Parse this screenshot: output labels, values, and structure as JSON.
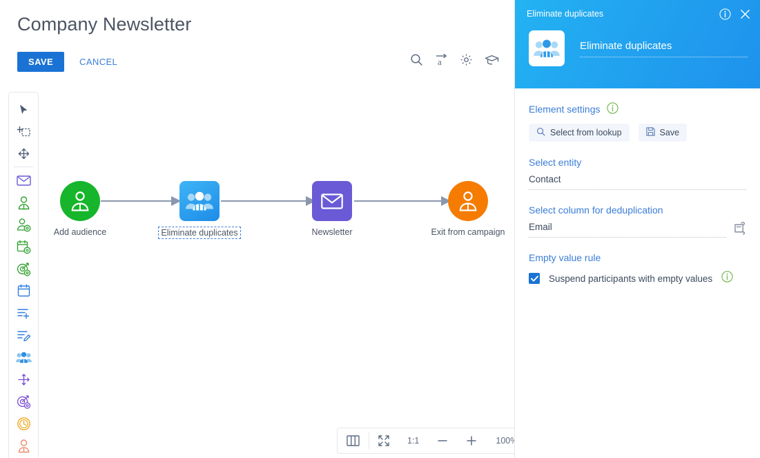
{
  "page": {
    "title": "Company Newsletter",
    "save_label": "SAVE",
    "cancel_label": "CANCEL"
  },
  "colors": {
    "primary_blue": "#1a73d4",
    "link_blue": "#3b7dd8",
    "panel_gradient_start": "#23b3f2",
    "panel_gradient_end": "#1e92ec",
    "node_green": "#16b52b",
    "node_blue": "#1d8ce8",
    "node_purple": "#6a5ad6",
    "node_orange": "#f57c00",
    "connector_gray": "#8b97ad",
    "info_green": "#6aba4a"
  },
  "canvas_tools": [
    {
      "name": "search-icon",
      "label": "Search"
    },
    {
      "name": "text-direction-icon",
      "label": "Text direction"
    },
    {
      "name": "gear-icon",
      "label": "Settings"
    },
    {
      "name": "graduation-cap-icon",
      "label": "Learning"
    }
  ],
  "tool_rail": [
    {
      "name": "pointer-icon",
      "label": "Select"
    },
    {
      "name": "add-selection-icon",
      "label": "Add to selection"
    },
    {
      "name": "move-icon",
      "label": "Move"
    },
    {
      "name": "separator",
      "label": ""
    },
    {
      "name": "envelope-icon",
      "label": "Email"
    },
    {
      "name": "audience-icon",
      "label": "Add audience"
    },
    {
      "name": "audience-filter-icon",
      "label": "Filter audience"
    },
    {
      "name": "calendar-clock-icon",
      "label": "Scheduled event"
    },
    {
      "name": "target-clock-icon",
      "label": "Timed goal"
    },
    {
      "name": "calendar-icon",
      "label": "Calendar"
    },
    {
      "name": "list-add-icon",
      "label": "Add record"
    },
    {
      "name": "list-edit-icon",
      "label": "Edit record"
    },
    {
      "name": "eliminate-duplicates-icon",
      "label": "Eliminate duplicates"
    },
    {
      "name": "split-flow-icon",
      "label": "Split flow"
    },
    {
      "name": "target-goal-icon",
      "label": "Goal"
    },
    {
      "name": "clock-icon",
      "label": "Wait"
    },
    {
      "name": "exit-person-icon",
      "label": "Exit from campaign"
    }
  ],
  "flow": {
    "nodes": [
      {
        "name": "add-audience",
        "label": "Add audience",
        "shape": "circle",
        "color": "green",
        "icon": "person-icon",
        "selected": false
      },
      {
        "name": "eliminate-duplicates",
        "label": "Eliminate duplicates",
        "shape": "square",
        "color": "blue",
        "icon": "group-icon",
        "selected": true
      },
      {
        "name": "newsletter",
        "label": "Newsletter",
        "shape": "square",
        "color": "purple",
        "icon": "envelope-icon",
        "selected": false
      },
      {
        "name": "exit-from-campaign",
        "label": "Exit from campaign",
        "shape": "circle",
        "color": "orange",
        "icon": "person-icon",
        "selected": false
      }
    ]
  },
  "zoombar": {
    "columns_icon": "columns-icon",
    "fit_icon": "fit-screen-icon",
    "actual_size_label": "1:1",
    "zoom_out_label": "—",
    "zoom_in_label": "+",
    "zoom_level": "100%"
  },
  "panel": {
    "header": {
      "title": "Eliminate duplicates",
      "info_icon": "info-icon",
      "close_icon": "close-icon",
      "element_icon": "eliminate-duplicates-icon",
      "element_name": "Eliminate duplicates"
    },
    "element_settings": {
      "heading": "Element settings",
      "info_icon": "info-icon",
      "lookup_button": "Select from lookup",
      "lookup_icon": "search-icon",
      "save_button": "Save",
      "save_icon": "floppy-disk-icon"
    },
    "select_entity": {
      "label": "Select entity",
      "value": "Contact"
    },
    "select_column": {
      "label": "Select column for deduplication",
      "value": "Email",
      "icon": "column-picker-icon"
    },
    "empty_value_rule": {
      "label": "Empty value rule",
      "checkbox_label": "Suspend participants with empty values",
      "checked": true,
      "info_icon": "info-icon"
    }
  }
}
